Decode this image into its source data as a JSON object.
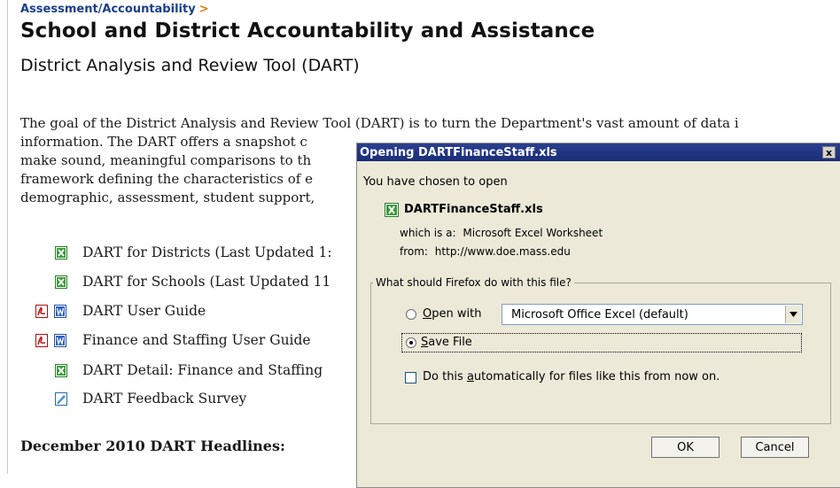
{
  "page": {
    "breadcrumb": "Assessment/Accountability",
    "breadcrumb_chevron": ">",
    "title": "School and District Accountability and Assistance",
    "subtitle": "District Analysis and Review Tool (DART)",
    "paragraph_lines": [
      "The goal of the District Analysis and Review Tool (DART) is to turn the Department's vast amount of data i",
      "information. The DART offers a snapshot c",
      "make sound, meaningful comparisons to th",
      "framework defining the characteristics of e",
      "demographic, assessment, student support,"
    ],
    "links": [
      {
        "label": "DART for Districts (Last Updated 1:",
        "icons": [
          "excel-icon"
        ]
      },
      {
        "label": "DART for Schools (Last Updated 11",
        "icons": [
          "excel-icon"
        ]
      },
      {
        "label": "DART User Guide",
        "icons": [
          "pdf-icon",
          "word-icon"
        ]
      },
      {
        "label": "Finance and Staffing User Guide",
        "icons": [
          "pdf-icon",
          "word-icon"
        ]
      },
      {
        "label": "DART Detail: Finance and Staffing",
        "icons": [
          "excel-icon"
        ]
      },
      {
        "label": "DART Feedback Survey",
        "icons": [
          "survey-icon"
        ]
      }
    ],
    "headline": "December 2010 DART Headlines:"
  },
  "dialog": {
    "title": "Opening DARTFinanceStaff.xls",
    "close_label": "x",
    "intro": "You have chosen to open",
    "filename": "DARTFinanceStaff.xls",
    "which_is_label": "which is a:",
    "which_is_value": "Microsoft Excel Worksheet",
    "from_label": "from:",
    "from_value": "http://www.doe.mass.edu",
    "group_legend": "What should Firefox do with this file?",
    "open_with_label": "Open with",
    "open_with_app": "Microsoft Office Excel (default)",
    "save_file_label": "Save File",
    "selected_option": "save_file",
    "auto_label_pre": "Do this ",
    "auto_label_accel": "a",
    "auto_label_post": "utomatically for files like this from now on.",
    "auto_checked": false,
    "ok_label": "OK",
    "cancel_label": "Cancel"
  },
  "colors": {
    "breadcrumb": "#1a3f8a",
    "breadcrumb_chevron": "#e07a10",
    "titlebar": "#1f3480",
    "dialog_bg": "#ece9d8"
  }
}
